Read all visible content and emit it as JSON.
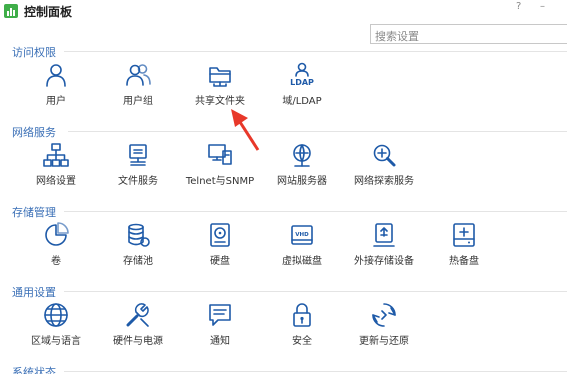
{
  "window": {
    "title": "控制面板",
    "help_glyph": "?",
    "minimize_glyph": "–"
  },
  "search": {
    "placeholder": "搜索设置"
  },
  "sections": [
    {
      "title": "访问权限",
      "items": [
        {
          "label": "用户",
          "icon": "user-icon"
        },
        {
          "label": "用户组",
          "icon": "user-group-icon"
        },
        {
          "label": "共享文件夹",
          "icon": "shared-folder-icon"
        },
        {
          "label": "域/LDAP",
          "icon": "ldap-icon",
          "icon_text": "LDAP"
        }
      ]
    },
    {
      "title": "网络服务",
      "items": [
        {
          "label": "网络设置",
          "icon": "network-icon"
        },
        {
          "label": "文件服务",
          "icon": "file-service-icon"
        },
        {
          "label": "Telnet与SNMP",
          "icon": "telnet-snmp-icon"
        },
        {
          "label": "网站服务器",
          "icon": "web-server-icon"
        },
        {
          "label": "网络探索服务",
          "icon": "network-discovery-icon"
        }
      ]
    },
    {
      "title": "存储管理",
      "items": [
        {
          "label": "卷",
          "icon": "volume-icon"
        },
        {
          "label": "存储池",
          "icon": "storage-pool-icon"
        },
        {
          "label": "硬盘",
          "icon": "hard-disk-icon"
        },
        {
          "label": "虚拟磁盘",
          "icon": "virtual-disk-icon",
          "icon_text": "VHD"
        },
        {
          "label": "外接存储设备",
          "icon": "external-storage-icon"
        },
        {
          "label": "热备盘",
          "icon": "hot-spare-icon"
        }
      ]
    },
    {
      "title": "通用设置",
      "items": [
        {
          "label": "区域与语言",
          "icon": "globe-icon"
        },
        {
          "label": "硬件与电源",
          "icon": "hardware-power-icon"
        },
        {
          "label": "通知",
          "icon": "notification-icon"
        },
        {
          "label": "安全",
          "icon": "security-lock-icon"
        },
        {
          "label": "更新与还原",
          "icon": "update-restore-icon"
        }
      ]
    },
    {
      "title": "系统状态",
      "items": []
    }
  ],
  "annotation": {
    "icon": "red-arrow-icon",
    "points_to": "共享文件夹"
  },
  "colors": {
    "accent": "#1e5aa8",
    "section_title": "#3a6fb6",
    "app_icon": "#3fae49",
    "arrow": "#e8382a"
  }
}
